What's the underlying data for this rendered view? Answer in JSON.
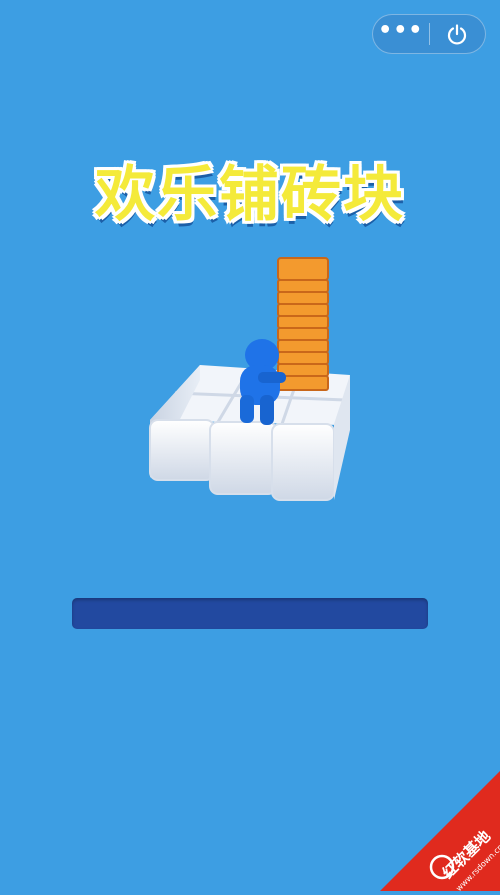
{
  "title": "欢乐铺砖块",
  "capsule": {
    "more_icon": "more-dots-icon",
    "more_glyph": "•••",
    "close_icon": "power-icon"
  },
  "loading": {
    "progress": 0
  },
  "watermark": {
    "brand_text": "红软基地",
    "url_text": "www.rsdown.cn"
  },
  "colors": {
    "background": "#3d9ee3",
    "progress_track": "#2249a0",
    "title_fill": "#f4ea3a",
    "brick": "#f39a2e",
    "character": "#1f73e8",
    "watermark": "#e02a1e"
  }
}
